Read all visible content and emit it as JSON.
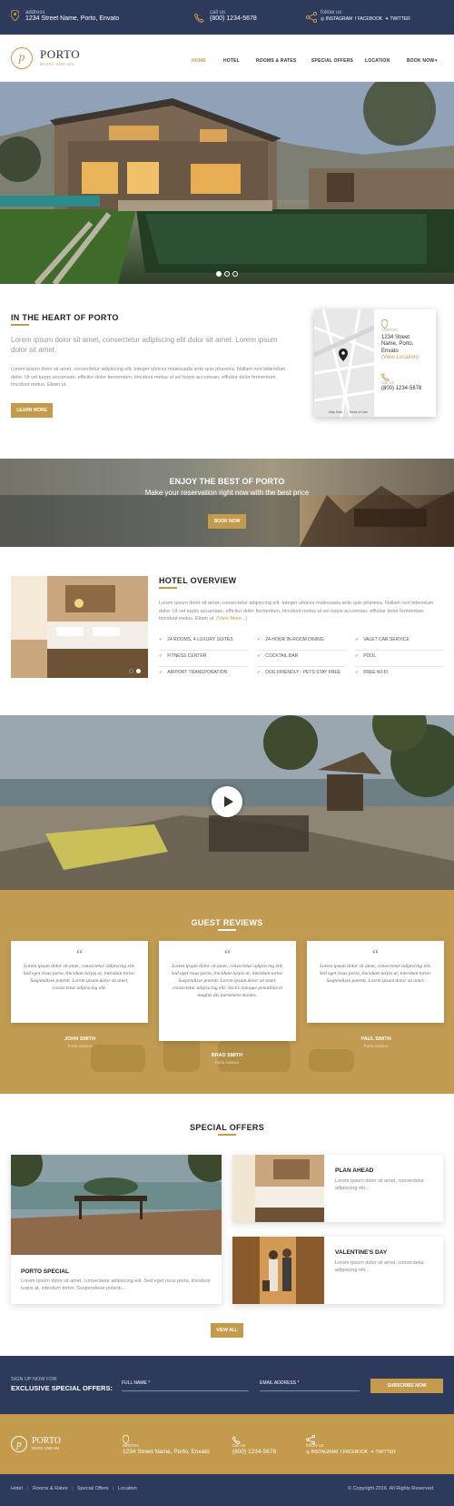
{
  "topbar": {
    "address_label": "address",
    "address_value": "1234 Street Name, Porto, Envato",
    "call_label": "call us",
    "call_value": "(800) 1234-5678",
    "follow_label": "follow us",
    "social": [
      "INSTAGRAM",
      "FACEBOOK",
      "TWITTER"
    ]
  },
  "header": {
    "logo_text": "PORTO",
    "logo_sub": "HOTEL AND SPA",
    "nav": [
      "HOME",
      "HOTEL",
      "ROOMS & RATES",
      "SPECIAL OFFERS",
      "LOCATION",
      "BOOK NOW"
    ],
    "active": "HOME"
  },
  "hero": {
    "slides": 3,
    "active_slide": 1
  },
  "intro": {
    "title": "IN THE HEART OF PORTO",
    "lead": "Lorem ipsum dolor sit amet, consectetur adipiscing elit dolor sit amet. Lorem ipsum dolor sit amet.",
    "body": "Lorem ipsum dolor sit amet, consectetur adipiscing elit. Integer ultrices malesuada ante quis pharetra. Nullam non bibendum dolor. Ut vel turpis accumsan, efficitur dolor fermentum, tincidunt metus ut vel turpis accumsan, efficitur dolor fermentum. tincidunt metus. Etiam ut.",
    "button": "LEARN MORE",
    "map": {
      "address_label": "address",
      "address_lines": [
        "1234 Street",
        "Name, Porto,",
        "Envato"
      ],
      "view_location": "(View Location)",
      "call_label": "call us",
      "phone": "(800) 1234-5678",
      "map_data": "Map Data",
      "terms": "Terms of Use"
    }
  },
  "banner": {
    "title": "ENJOY THE BEST OF PORTO",
    "subtitle": "Make your reservation right now with the best price",
    "button": "BOOK NOW"
  },
  "overview": {
    "title": "HOTEL OVERVIEW",
    "body": "Lorem ipsum dolor sit amet, consectetur adipiscing elit. Integer ultrices malesuada ante quis pharetra. Nullam non bibendum dolor. Ut vel turpis accumsan, efficitur dolor fermentum, tincidunt metus ut vel turpis accumsan, efficitur dolor fermentum. tincidunt metus. Etiam ut.",
    "view_more": "(View More...)",
    "amenities": [
      "24 ROOMS, 4 LUXURY SUITES",
      "24-HOUR IN-ROOM DINING",
      "VALET CAR SERVICE",
      "FITNESS CENTER",
      "COCKTAIL BAR",
      "POOL",
      "AIRPORT TRANSPORATION",
      "DOG FRIENDLY - PETS STAY FREE",
      "FREE WI-FI"
    ],
    "slides": 2
  },
  "reviews": {
    "title": "GUEST REVIEWS",
    "items": [
      {
        "text": "Lorem ipsum dolor sit amet, consectetur adipiscing elit. Sed eget risus porta, tincidunt turpis at, interdum tortor. Suspendisse potenti. Lorem ipsum dolor sit amet, consectetur adipiscing elit.",
        "name": "JOHN SMITH",
        "role": "Porto Advisor"
      },
      {
        "text": "Lorem ipsum dolor sit amet, consectetur adipiscing elit. Sed eget risus porta, tincidunt turpis at, interdum tortor. Suspendisse potenti. Lorem ipsum dolor sit amet, consectetur adipiscing elit. Sociis natoque penatibus et magnis dis parturient montes.",
        "name": "BRAD SMITH",
        "role": "Porto Advisor"
      },
      {
        "text": "Lorem ipsum dolor sit amet, consectetur adipiscing elit. Sed eget risus porta, tincidunt turpis at, interdum tortor. Suspendisse potenti. Lorem ipsum dolor sit amet.",
        "name": "PAUL SMITH",
        "role": "Porto Advisor"
      }
    ]
  },
  "offers": {
    "title": "SPECIAL OFFERS",
    "main": {
      "title": "PORTO SPECIAL",
      "text": "Lorem ipsum dolor sit amet, consectetur adipiscing elit. Sed eget risus porta, tincidunt turpis at, interdum tortor. Suspendisse potenti..."
    },
    "side": [
      {
        "title": "PLAN AHEAD",
        "text": "Lorem ipsum dolor sit amet, consectetur adipiscing elit..."
      },
      {
        "title": "VALENTINE'S DAY",
        "text": "Lorem ipsum dolor sit amet, consectetur adipiscing elit..."
      }
    ],
    "button": "VIEW ALL"
  },
  "signup": {
    "small": "SIGN UP NOW FOR",
    "big": "EXCLUSIVE SPECIAL OFFERS:",
    "name_label": "FULL NAME *",
    "email_label": "EMAIL ADDRESS *",
    "button": "SUBSCRIBE NOW"
  },
  "footer": {
    "logo_text": "PORTO",
    "logo_sub": "HOTEL AND SPA",
    "address_label": "address",
    "address_value": "1234 Street Name, Porto, Envato",
    "call_label": "call us",
    "call_value": "(800) 1234-5678",
    "follow_label": "follow us",
    "social": [
      "INSTAGRAM",
      "FACEBOOK",
      "TWITTER"
    ],
    "links": [
      "Hotel",
      "Rooms & Rates",
      "Special Offers",
      "Location"
    ],
    "copyright": "© Copyright 2016. All Rights Reserved."
  },
  "colors": {
    "navy": "#2e3a5c",
    "gold": "#c49a4c"
  }
}
